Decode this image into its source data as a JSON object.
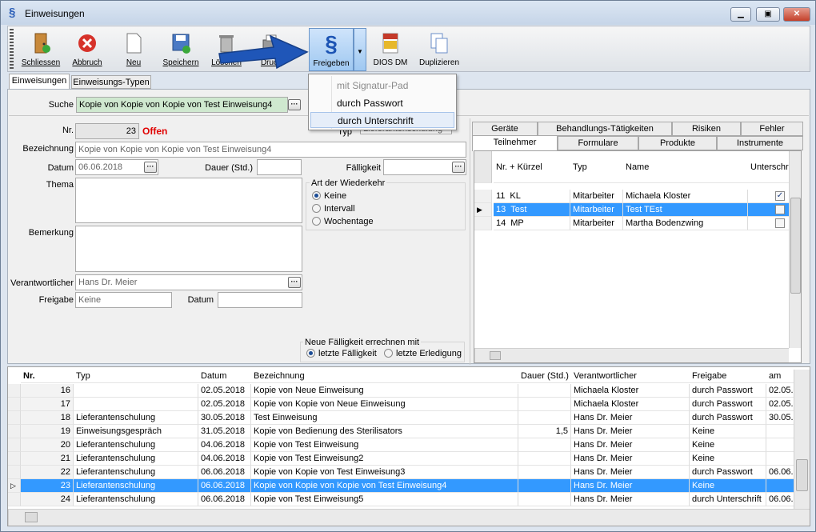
{
  "window": {
    "title": "Einweisungen"
  },
  "toolbar": {
    "close": "Schliessen",
    "cancel": "Abbruch",
    "new": "Neu",
    "save": "Speichern",
    "delete": "Löschen",
    "print": "Druck",
    "release": "Freigeben",
    "dios": "DIOS DM",
    "duplicate": "Duplizieren"
  },
  "release_menu": {
    "items": [
      "mit Signatur-Pad",
      "durch Passwort",
      "durch Unterschrift"
    ]
  },
  "tabs": {
    "main": [
      "Einweisungen",
      "Einweisungs-Typen"
    ]
  },
  "search": {
    "label": "Suche",
    "value": "Kopie von Kopie von Kopie von Test Einweisung4"
  },
  "form": {
    "nr_label": "Nr.",
    "nr": "23",
    "status": "Offen",
    "typ_label": "Typ",
    "typ_value": "Lieferantenschulung",
    "bez_label": "Bezeichnung",
    "bez": "Kopie von Kopie von Kopie von Test Einweisung4",
    "datum_label": "Datum",
    "datum": "06.06.2018",
    "dauer_label": "Dauer (Std.)",
    "faellig_label": "Fälligkeit",
    "thema_label": "Thema",
    "bemerkung_label": "Bemerkung",
    "wiederkehr_label": "Art der Wiederkehr",
    "wk_opts": [
      "Keine",
      "Intervall",
      "Wochentage"
    ],
    "verantw_label": "Verantwortlicher",
    "verantw": "Hans Dr. Meier",
    "freigabe_label": "Freigabe",
    "freigabe": "Keine",
    "fdatum_label": "Datum",
    "neu_faellig_label": "Neue Fälligkeit errechnen mit",
    "nf_opts": [
      "letzte Fälligkeit",
      "letzte Erledigung"
    ]
  },
  "right_tabs": {
    "row1": [
      "Geräte",
      "Behandlungs-Tätigkeiten",
      "Risiken",
      "Fehler"
    ],
    "row2": [
      "Teilnehmer",
      "Formulare",
      "Produkte",
      "Instrumente"
    ]
  },
  "participants": {
    "headers": [
      "Nr. + Kürzel",
      "Typ",
      "Name",
      "Unterschri"
    ],
    "rows": [
      {
        "nr": "11",
        "k": "KL",
        "typ": "Mitarbeiter",
        "name": "Michaela  Kloster",
        "signed": true
      },
      {
        "nr": "13",
        "k": "Test",
        "typ": "Mitarbeiter",
        "name": "Test  TEst",
        "signed": false
      },
      {
        "nr": "14",
        "k": "MP",
        "typ": "Mitarbeiter",
        "name": "Martha  Bodenzwing",
        "signed": false
      }
    ]
  },
  "table": {
    "headers": [
      "Nr.",
      "Typ",
      "Datum",
      "Bezeichnung",
      "Dauer (Std.)",
      "Verantwortlicher",
      "Freigabe",
      "am"
    ],
    "rows": [
      [
        "16",
        "",
        "02.05.2018",
        "Kopie von Neue Einweisung",
        "",
        "Michaela  Kloster",
        "durch Passwort",
        "02.05.2"
      ],
      [
        "17",
        "",
        "02.05.2018",
        "Kopie von Kopie von Neue Einweisung",
        "",
        "Michaela  Kloster",
        "durch Passwort",
        "02.05.2"
      ],
      [
        "18",
        "Lieferantenschulung",
        "30.05.2018",
        "Test Einweisung",
        "",
        "Hans Dr. Meier",
        "durch Passwort",
        "30.05.2"
      ],
      [
        "19",
        "Einweisungsgespräch",
        "31.05.2018",
        "Kopie von Bedienung des Sterilisators",
        "1,5",
        "Hans Dr. Meier",
        "Keine",
        ""
      ],
      [
        "20",
        "Lieferantenschulung",
        "04.06.2018",
        "Kopie von Test Einweisung",
        "",
        "Hans Dr. Meier",
        "Keine",
        ""
      ],
      [
        "21",
        "Lieferantenschulung",
        "04.06.2018",
        "Kopie von Test Einweisung2",
        "",
        "Hans Dr. Meier",
        "Keine",
        ""
      ],
      [
        "22",
        "Lieferantenschulung",
        "06.06.2018",
        "Kopie von Kopie von Test Einweisung3",
        "",
        "Hans Dr. Meier",
        "durch Passwort",
        "06.06.2"
      ],
      [
        "23",
        "Lieferantenschulung",
        "06.06.2018",
        "Kopie von Kopie von Kopie von Test Einweisung4",
        "",
        "Hans Dr. Meier",
        "Keine",
        ""
      ],
      [
        "24",
        "Lieferantenschulung",
        "06.06.2018",
        "Kopie von Test Einweisung5",
        "",
        "Hans Dr. Meier",
        "durch Unterschrift",
        "06.06.2"
      ]
    ]
  }
}
